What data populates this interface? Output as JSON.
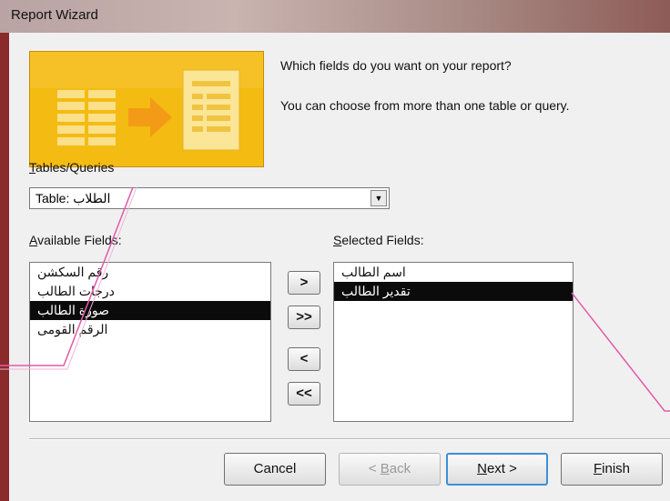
{
  "window": {
    "title": "Report Wizard"
  },
  "prompt": {
    "question": "Which fields do you want on your report?",
    "hint": "You can choose from more than one table or query."
  },
  "tables_queries": {
    "label_accel": "T",
    "label_rest": "ables/Queries",
    "selected_value": "Table: الطلاب"
  },
  "available_fields": {
    "label_accel": "A",
    "label_rest": "vailable Fields:",
    "items": [
      {
        "text": "رقم السكشن",
        "selected": false
      },
      {
        "text": "درجات الطالب",
        "selected": false
      },
      {
        "text": "صورة الطالب",
        "selected": true
      },
      {
        "text": "الرقم القومى",
        "selected": false
      }
    ]
  },
  "selected_fields": {
    "label_accel": "S",
    "label_rest": "elected Fields:",
    "items": [
      {
        "text": "اسم الطالب",
        "selected": false
      },
      {
        "text": "تقدير الطالب",
        "selected": true
      }
    ]
  },
  "move_buttons": {
    "add_one": ">",
    "add_all": ">>",
    "remove_one": "<",
    "remove_all": "<<"
  },
  "buttons": {
    "cancel": "Cancel",
    "back_accel": "B",
    "back_rest": "ack",
    "back_prefix": "< ",
    "next_accel": "N",
    "next_rest": "ext >",
    "finish_accel": "F",
    "finish_rest": "inish"
  },
  "colors": {
    "selection_bg": "#0b0b0b",
    "banner": "#f2b90f",
    "annotation_line": "#e25aa9"
  }
}
